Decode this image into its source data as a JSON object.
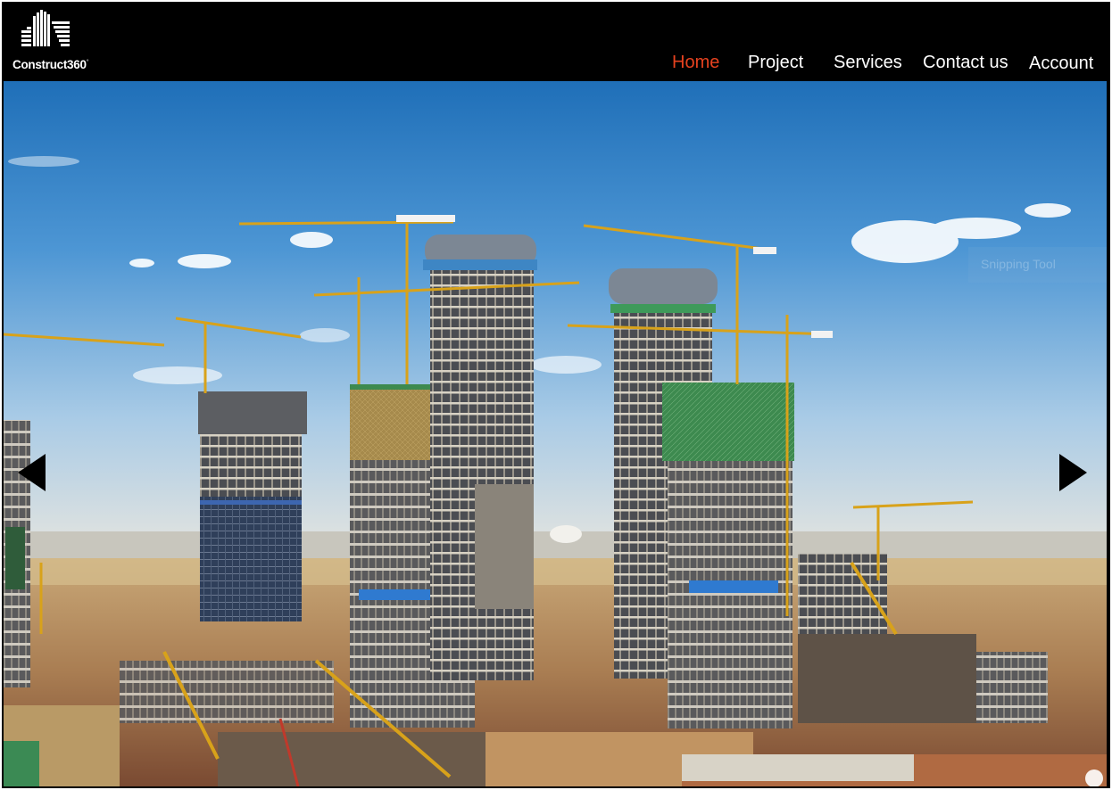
{
  "brand": {
    "name": "Construct360",
    "logo_icon": "buildings-logo-icon"
  },
  "nav": {
    "items": [
      {
        "label": "Home",
        "active": true
      },
      {
        "label": "Project",
        "active": false
      },
      {
        "label": "Services",
        "active": false
      },
      {
        "label": "Contact us",
        "active": false
      },
      {
        "label": "Account",
        "active": false
      }
    ]
  },
  "hero": {
    "image": "construction-site-skyscrapers-cranes",
    "overlay_text": "Snipping Tool",
    "prev_icon": "left-triangle-arrow",
    "next_icon": "right-triangle-arrow"
  },
  "colors": {
    "nav_bg": "#000000",
    "nav_text": "#ffffff",
    "nav_active": "#e6421f"
  }
}
